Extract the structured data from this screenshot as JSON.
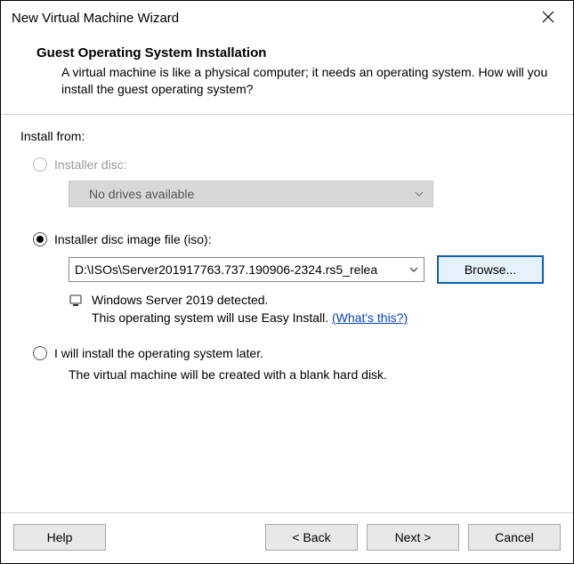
{
  "window": {
    "title": "New Virtual Machine Wizard"
  },
  "header": {
    "title": "Guest Operating System Installation",
    "description": "A virtual machine is like a physical computer; it needs an operating system. How will you install the guest operating system?"
  },
  "content": {
    "install_from_label": "Install from:",
    "option_disc": {
      "label": "Installer disc:",
      "dropdown_text": "No drives available",
      "enabled": false
    },
    "option_iso": {
      "label": "Installer disc image file (iso):",
      "value": "D:\\ISOs\\Server201917763.737.190906-2324.rs5_relea",
      "browse_label": "Browse...",
      "selected": true
    },
    "detection": {
      "line1": "Windows Server 2019 detected.",
      "line2_prefix": "This operating system will use Easy Install. ",
      "link_text": "(What's this?)"
    },
    "option_later": {
      "label": "I will install the operating system later.",
      "description": "The virtual machine will be created with a blank hard disk."
    }
  },
  "footer": {
    "help": "Help",
    "back": "< Back",
    "next": "Next >",
    "cancel": "Cancel"
  }
}
